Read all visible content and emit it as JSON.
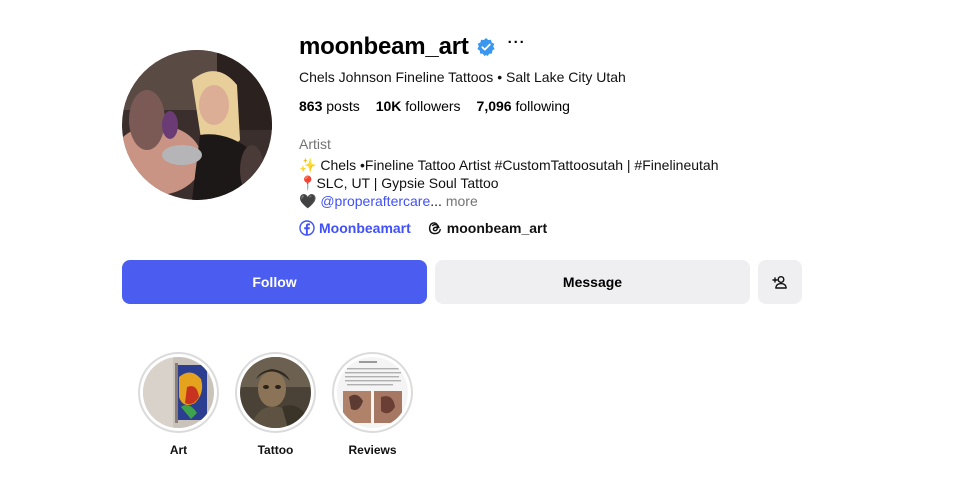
{
  "profile": {
    "username": "moonbeam_art",
    "full_name_line": "Chels Johnson Fineline Tattoos • Salt Lake City Utah",
    "more_icon": "ellipsis-icon",
    "verified_icon": "verified-badge-icon"
  },
  "stats": {
    "posts_count": "863",
    "posts_label": " posts",
    "followers_count": "10K",
    "followers_label": " followers",
    "following_count": "7,096",
    "following_label": " following"
  },
  "bio": {
    "category": "Artist",
    "line1_emoji": "✨",
    "line1_text": " Chels •Fineline Tattoo Artist #CustomTattoosutah | #Finelineutah",
    "line2_emoji": "📍",
    "line2_text": "SLC, UT | Gypsie Soul Tattoo",
    "line3_emoji": "🖤",
    "line3_mention": "@properaftercare",
    "line3_ellipsis": "...",
    "line3_more": " more"
  },
  "links": {
    "facebook_label": "Moonbeamart",
    "threads_label": "moonbeam_art"
  },
  "actions": {
    "follow_label": "Follow",
    "message_label": "Message",
    "suggest_icon": "add-person-icon"
  },
  "highlights": [
    {
      "label": "Art"
    },
    {
      "label": "Tattoo"
    },
    {
      "label": "Reviews"
    }
  ],
  "colors": {
    "accent": "#4a5df0",
    "link": "#4150f7",
    "secondary_button": "#efeff2",
    "muted_text": "#737373",
    "verified": "#3897f0"
  }
}
